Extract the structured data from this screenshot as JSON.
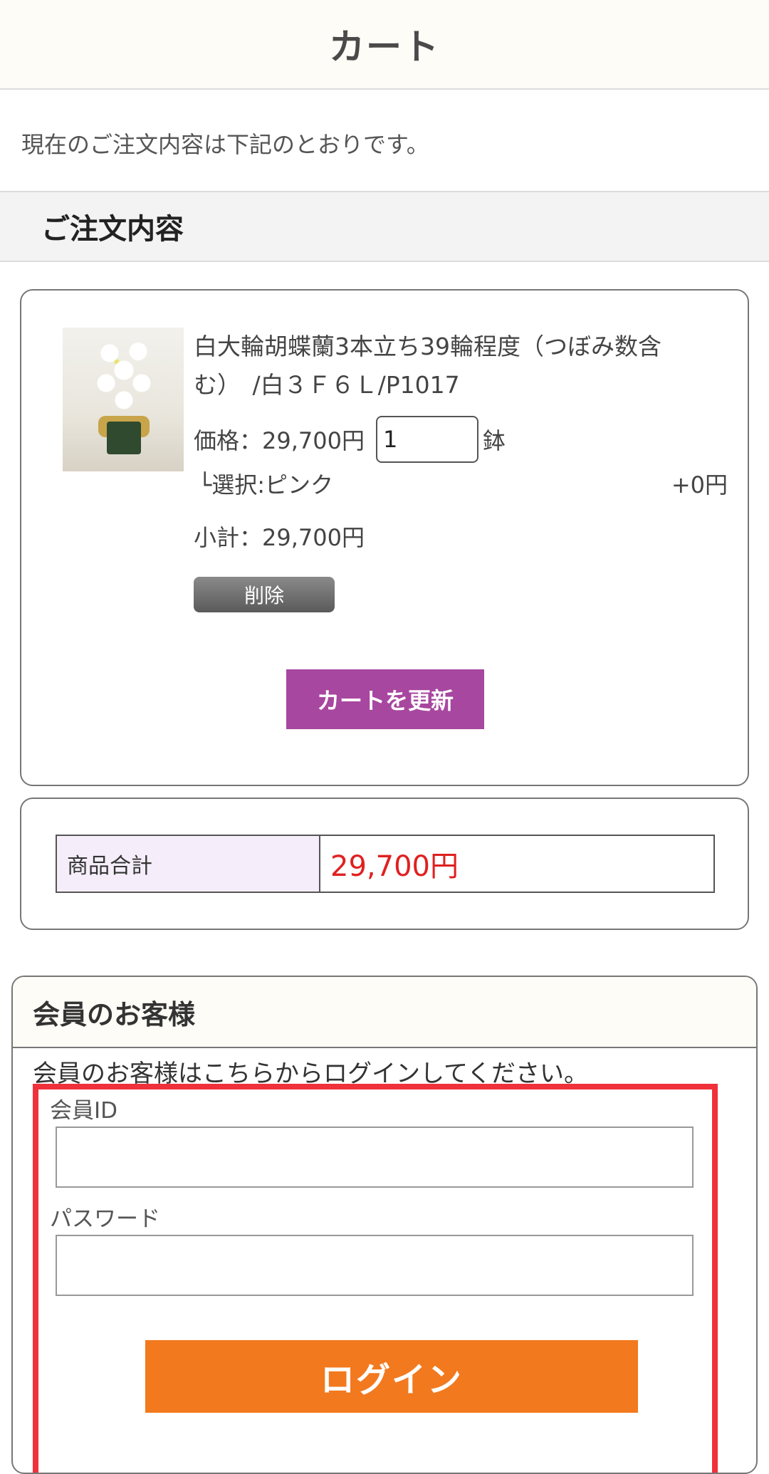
{
  "header": {
    "title": "カート"
  },
  "intro": "現在のご注文内容は下記のとおりです。",
  "order_section": {
    "title": "ご注文内容"
  },
  "cart_item": {
    "name": "白大輪胡蝶蘭3本立ち39輪程度（つぼみ数含む）　/白３Ｆ６Ｌ/P1017",
    "price_label": "価格：29,700円",
    "quantity": "1",
    "unit": "鉢",
    "option_label": "└選択:ピンク",
    "option_price": "+0円",
    "subtotal_label": "小計：29,700円",
    "delete_label": "削除",
    "image": "orchid-product-image"
  },
  "update_button": "カートを更新",
  "totals": {
    "label": "商品合計",
    "value": "29,700円"
  },
  "member": {
    "title": "会員のお客様",
    "description": "会員のお客様はこちらからログインしてください。",
    "id_label": "会員ID",
    "password_label": "パスワード",
    "login_button": "ログイン"
  },
  "colors": {
    "accent_purple": "#a7479f",
    "login_orange": "#f2791e",
    "total_red": "#e02020",
    "highlight_red": "#f0303a"
  }
}
